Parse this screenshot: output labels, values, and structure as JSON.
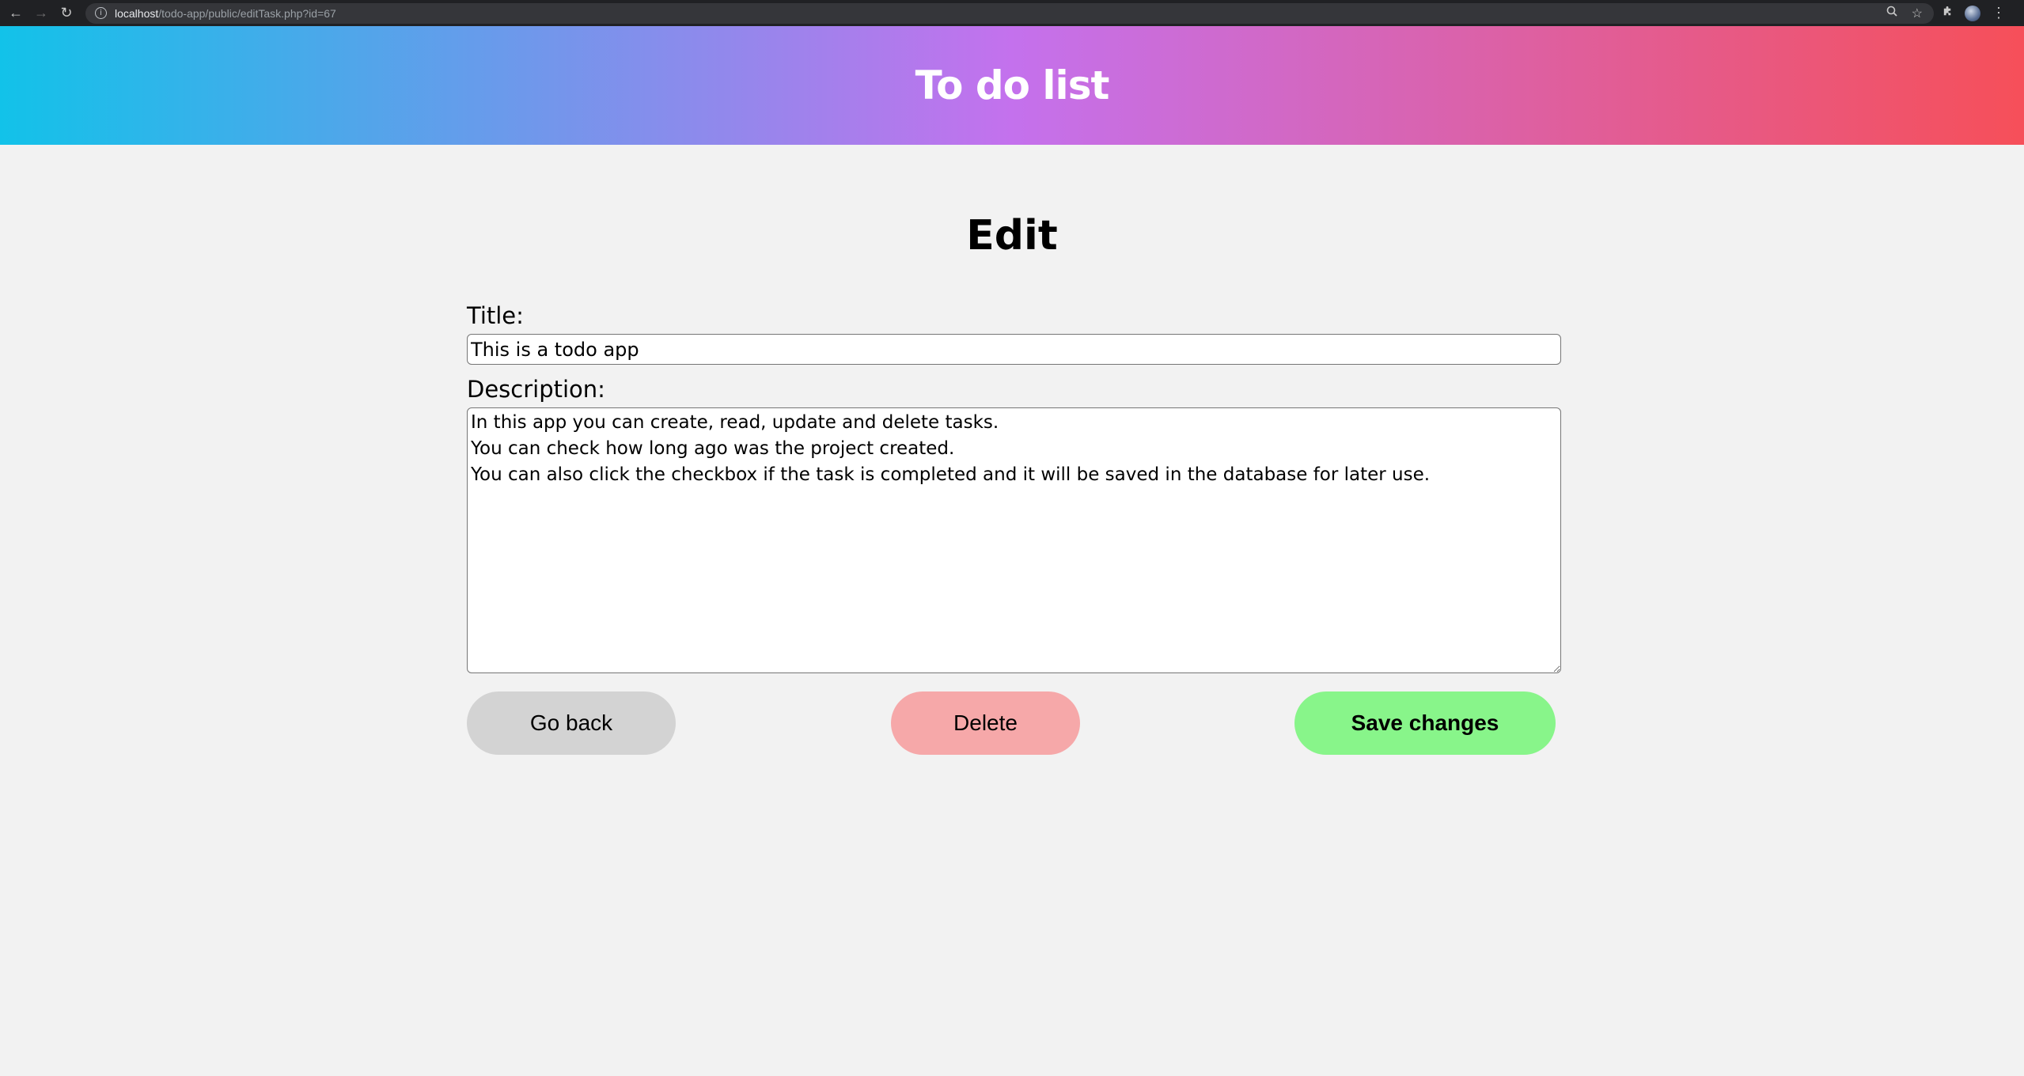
{
  "browser": {
    "url_host": "localhost",
    "url_path": "/todo-app/public/editTask.php?id=67"
  },
  "header": {
    "title": "To do list",
    "gradient": [
      "#12c2e9",
      "#c471ed",
      "#f64f59"
    ]
  },
  "main": {
    "heading": "Edit",
    "title_label": "Title:",
    "title_value": "This is a todo app",
    "description_label": "Description:",
    "description_value": "In this app you can create, read, update and delete tasks.\nYou can check how long ago was the project created.\nYou can also click the checkbox if the task is completed and it will be saved in the database for later use."
  },
  "actions": {
    "back_label": "Go back",
    "delete_label": "Delete",
    "save_label": "Save changes",
    "colors": {
      "back": "#d3d3d3",
      "delete": "#f6a8a9",
      "save": "#88f58a"
    }
  }
}
